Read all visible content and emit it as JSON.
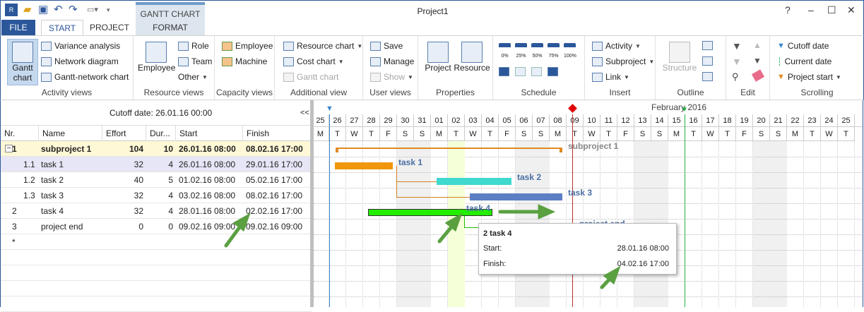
{
  "window": {
    "title": "Project1",
    "context_tab_title": "GANTT CHART"
  },
  "tabs": [
    {
      "label": "FILE"
    },
    {
      "label": "START"
    },
    {
      "label": "PROJECT"
    },
    {
      "label": "FORMAT"
    }
  ],
  "ribbon": {
    "activity_views": {
      "label": "Activity views",
      "gantt": "Gantt chart",
      "gantt_l1": "Gantt",
      "gantt_l2": "chart",
      "variance": "Variance analysis",
      "network": "Network diagram",
      "gantt_network": "Gantt-network chart"
    },
    "resource_views": {
      "label": "Resource views",
      "employee": "Employee",
      "role": "Role",
      "team": "Team",
      "other": "Other"
    },
    "capacity_views": {
      "label": "Capacity views",
      "employee": "Employee",
      "machine": "Machine"
    },
    "additional_view": {
      "label": "Additional view",
      "resource_chart": "Resource chart",
      "cost_chart": "Cost chart",
      "gantt_chart": "Gantt chart"
    },
    "user_views": {
      "label": "User views",
      "save": "Save",
      "manage": "Manage",
      "show": "Show"
    },
    "properties": {
      "label": "Properties",
      "project": "Project",
      "resource": "Resource"
    },
    "schedule": {
      "label": "Schedule",
      "pcts": [
        "0%",
        "25%",
        "50%",
        "75%",
        "100%"
      ]
    },
    "insert": {
      "label": "Insert",
      "activity": "Activity",
      "subproject": "Subproject",
      "link": "Link"
    },
    "outline": {
      "label": "Outline",
      "structure": "Structure"
    },
    "edit": {
      "label": "Edit"
    },
    "scrolling": {
      "label": "Scrolling",
      "cutoff": "Cutoff date",
      "current": "Current date",
      "project_start": "Project start"
    }
  },
  "table": {
    "cutoff": "Cutoff date: 26.01.16 00:00",
    "collapse": "<<",
    "columns": [
      "Nr.",
      "Name",
      "Effort",
      "Dur...",
      "Start",
      "Finish"
    ],
    "rows": [
      {
        "nr": "1",
        "name": "subproject 1",
        "effort": "104",
        "dur": "10",
        "start": "26.01.16 08:00",
        "finish": "08.02.16 17:00",
        "expander": "−"
      },
      {
        "nr": "1.1",
        "name": "task 1",
        "effort": "32",
        "dur": "4",
        "start": "26.01.16 08:00",
        "finish": "29.01.16 17:00"
      },
      {
        "nr": "1.2",
        "name": "task 2",
        "effort": "40",
        "dur": "5",
        "start": "01.02.16 08:00",
        "finish": "05.02.16 17:00"
      },
      {
        "nr": "1.3",
        "name": "task 3",
        "effort": "32",
        "dur": "4",
        "start": "03.02.16 08:00",
        "finish": "08.02.16 17:00"
      },
      {
        "nr": "2",
        "name": "task 4",
        "effort": "32",
        "dur": "4",
        "start": "28.01.16 08:00",
        "finish": "02.02.16 17:00"
      },
      {
        "nr": "3",
        "name": "project end",
        "effort": "0",
        "dur": "0",
        "start": "09.02.16 09:00",
        "finish": "09.02.16 09:00"
      },
      {
        "nr": "*",
        "name": "",
        "effort": "",
        "dur": "",
        "start": "",
        "finish": ""
      }
    ]
  },
  "gantt": {
    "month": "February 2016",
    "days": [
      "25",
      "26",
      "27",
      "28",
      "29",
      "30",
      "31",
      "01",
      "02",
      "03",
      "04",
      "05",
      "06",
      "07",
      "08",
      "09",
      "10",
      "11",
      "12",
      "13",
      "14",
      "15",
      "16",
      "17",
      "18",
      "19",
      "20",
      "21",
      "22",
      "23",
      "24",
      "25"
    ],
    "weekdays": [
      "M",
      "T",
      "W",
      "T",
      "F",
      "S",
      "S",
      "M",
      "T",
      "W",
      "T",
      "F",
      "S",
      "S",
      "M",
      "T",
      "W",
      "T",
      "F",
      "S",
      "S",
      "M",
      "T",
      "W",
      "T",
      "F",
      "S",
      "S",
      "M",
      "T",
      "W",
      "T"
    ],
    "labels": {
      "subproject": "subproject 1",
      "task1": "task 1",
      "task2": "task 2",
      "task3": "task 3",
      "task4": "task 4",
      "project_end": "project end"
    },
    "colors": {
      "task1": "#f0960a",
      "task2": "#3fd9cf",
      "task3": "#5b7ec4",
      "task4": "#22ee00",
      "cutoff": "#3a88d0",
      "milestone": "#e00000",
      "today": "#20b040"
    },
    "tooltip": {
      "title": "2 task 4",
      "start_label": "Start:",
      "start_value": "28.01.16 08:00",
      "finish_label": "Finish:",
      "finish_value": "04.02.16 17:00"
    }
  }
}
